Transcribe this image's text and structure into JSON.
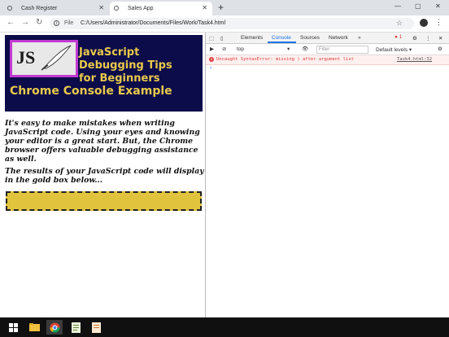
{
  "browser": {
    "tabs": [
      {
        "label": "Cash Register"
      },
      {
        "label": "Sales App"
      }
    ],
    "new_tab": "+",
    "window_controls": [
      "—",
      "▢",
      "✕"
    ],
    "file_label": "File",
    "url": "C:/Users/Administrator/Documents/Files/Work/Task4.html"
  },
  "page": {
    "banner": {
      "logo_text": "JS",
      "line1": "JavaScript",
      "line2": "Debugging Tips",
      "line3": "for Beginners",
      "line4": "Chrome Console Example"
    },
    "para1": "It's easy to make mistakes when writing JavaScript code. Using your eyes and knowing your editor is a great start. But, the Chrome browser offers valuable debugging assistance as well.",
    "para2": "The results of your JavaScript code will display in the gold box below..."
  },
  "devtools": {
    "tabs": [
      "Elements",
      "Console",
      "Sources",
      "Network",
      "»"
    ],
    "active_tab": "Console",
    "error_count": "1",
    "context": "top",
    "filter_placeholder": "Filter",
    "levels": "Default levels ▾",
    "error": {
      "message": "Uncaught SyntaxError: missing ) after argument list",
      "source": "Task4.html:32"
    },
    "prompt": "›"
  },
  "colors": {
    "banner_bg": "#0c0c4a",
    "banner_text": "#e8c94b",
    "logo_border": "#c23ad1",
    "gold_box": "#e2c33d",
    "error_red": "#e03b3b",
    "accent_blue": "#1a73e8"
  }
}
